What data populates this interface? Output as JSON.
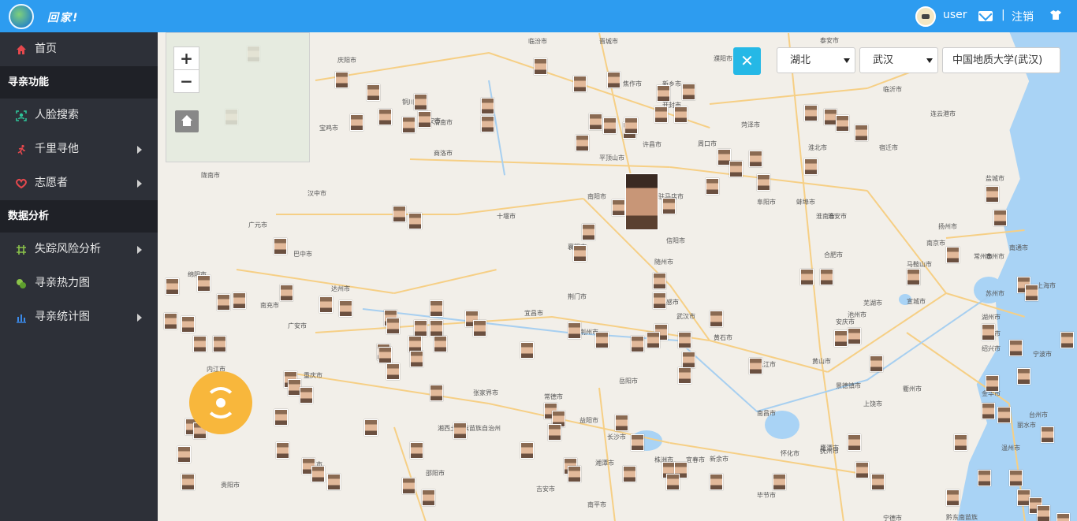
{
  "header": {
    "brand": "回家!",
    "user_name": "user",
    "separator": "|",
    "logout_label": "注销"
  },
  "sidebar": {
    "home": "首页",
    "section_search": "寻亲功能",
    "face_search": "人脸搜索",
    "thousand_miles": "千里寻他",
    "volunteer": "志愿者",
    "section_analysis": "数据分析",
    "risk_analysis": "失踪风险分析",
    "heatmap": "寻亲热力图",
    "statistics": "寻亲统计图"
  },
  "map": {
    "zoom_in": "+",
    "zoom_out": "−",
    "province_select": "湖北",
    "city_select": "武汉",
    "location": "中国地质大学(武汉)",
    "cities": [
      {
        "name": "临汾市"
      },
      {
        "name": "晋城市"
      },
      {
        "name": "濮阳市"
      },
      {
        "name": "泰安市"
      },
      {
        "name": "庆阳市"
      },
      {
        "name": "铜川市"
      },
      {
        "name": "渭南市"
      },
      {
        "name": "焦作市"
      },
      {
        "name": "新乡市"
      },
      {
        "name": "开封市"
      },
      {
        "name": "菏泽市"
      },
      {
        "name": "临沂市"
      },
      {
        "name": "宝鸡市"
      },
      {
        "name": "西安市"
      },
      {
        "name": "商洛市"
      },
      {
        "name": "平顶山市"
      },
      {
        "name": "许昌市"
      },
      {
        "name": "周口市"
      },
      {
        "name": "淮北市"
      },
      {
        "name": "宿迁市"
      },
      {
        "name": "连云港市"
      },
      {
        "name": "陇南市"
      },
      {
        "name": "汉中市"
      },
      {
        "name": "南阳市"
      },
      {
        "name": "驻马店市"
      },
      {
        "name": "阜阳市"
      },
      {
        "name": "蚌埠市"
      },
      {
        "name": "盐城市"
      },
      {
        "name": "淮安市"
      },
      {
        "name": "十堰市"
      },
      {
        "name": "广元市"
      },
      {
        "name": "信阳市"
      },
      {
        "name": "淮南市"
      },
      {
        "name": "扬州市"
      },
      {
        "name": "南京市"
      },
      {
        "name": "泰州市"
      },
      {
        "name": "南通市"
      },
      {
        "name": "巴中市"
      },
      {
        "name": "襄阳市"
      },
      {
        "name": "随州市"
      },
      {
        "name": "合肥市"
      },
      {
        "name": "马鞍山市"
      },
      {
        "name": "常州市"
      },
      {
        "name": "苏州市"
      },
      {
        "name": "上海市"
      },
      {
        "name": "绵阳市"
      },
      {
        "name": "达州市"
      },
      {
        "name": "南充市"
      },
      {
        "name": "荆门市"
      },
      {
        "name": "孝感市"
      },
      {
        "name": "芜湖市"
      },
      {
        "name": "宣城市"
      },
      {
        "name": "湖州市"
      },
      {
        "name": "广安市"
      },
      {
        "name": "宜昌市"
      },
      {
        "name": "荆州市"
      },
      {
        "name": "武汉市"
      },
      {
        "name": "黄石市"
      },
      {
        "name": "安庆市"
      },
      {
        "name": "池州市"
      },
      {
        "name": "杭州市"
      },
      {
        "name": "绍兴市"
      },
      {
        "name": "宁波市"
      },
      {
        "name": "内江市"
      },
      {
        "name": "重庆市"
      },
      {
        "name": "九江市"
      },
      {
        "name": "黄山市"
      },
      {
        "name": "岳阳市"
      },
      {
        "name": "景德镇市"
      },
      {
        "name": "衢州市"
      },
      {
        "name": "金华市"
      },
      {
        "name": "台州市"
      },
      {
        "name": "张家界市"
      },
      {
        "name": "常德市"
      },
      {
        "name": "益阳市"
      },
      {
        "name": "南昌市"
      },
      {
        "name": "上饶市"
      },
      {
        "name": "丽水市"
      },
      {
        "name": "温州市"
      },
      {
        "name": "湘西土家族苗族自治州"
      },
      {
        "name": "长沙市"
      },
      {
        "name": "鹰潭市"
      },
      {
        "name": "铜仁市"
      },
      {
        "name": "遵义市"
      },
      {
        "name": "湘潭市"
      },
      {
        "name": "株洲市"
      },
      {
        "name": "宜春市"
      },
      {
        "name": "新余市"
      },
      {
        "name": "抚州市"
      },
      {
        "name": "怀化市"
      },
      {
        "name": "邵阳市"
      },
      {
        "name": "吉安市"
      },
      {
        "name": "毕节市"
      },
      {
        "name": "贵阳市"
      },
      {
        "name": "衡阳市"
      },
      {
        "name": "南平市"
      },
      {
        "name": "宁德市"
      },
      {
        "name": "黔东南苗族"
      }
    ]
  }
}
